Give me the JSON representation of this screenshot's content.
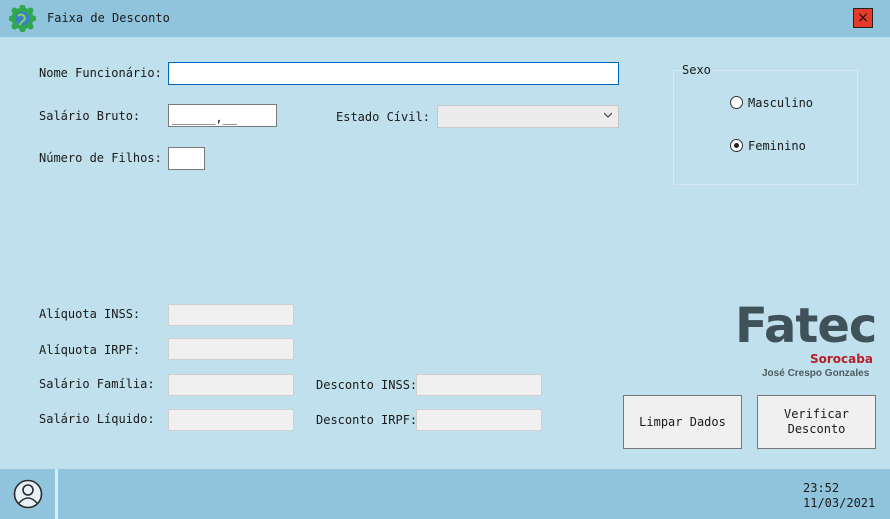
{
  "window": {
    "title": "Faixa de Desconto",
    "close_icon": "×"
  },
  "form": {
    "nome_label": "Nome Funcionário:",
    "nome_value": "",
    "salario_bruto_label": "Salário Bruto:",
    "salario_bruto_mask": "______,__",
    "estado_civil_label": "Estado Cívil:",
    "estado_civil_value": "",
    "filhos_label": "Número de Filhos:",
    "filhos_value": ""
  },
  "sexo": {
    "title": "Sexo",
    "masculino": "Masculino",
    "feminino": "Feminino",
    "selected": "Feminino"
  },
  "results": {
    "aliquota_inss_label": "Alíquota INSS:",
    "aliquota_irpf_label": "Alíquota IRPF:",
    "salario_familia_label": "Salário Família:",
    "salario_liquido_label": "Salário Líquido:",
    "desconto_inss_label": "Desconto INSS:",
    "desconto_irpf_label": "Desconto IRPF:"
  },
  "buttons": {
    "limpar": "Limpar Dados",
    "verificar_line1": "Verificar",
    "verificar_line2": "Desconto"
  },
  "logo": {
    "fatec": "Fatec",
    "sorocaba": "Sorocaba",
    "name": "José Crespo Gonzales"
  },
  "taskbar": {
    "time": "23:52",
    "date": "11/03/2021"
  },
  "colors": {
    "background": "#bfe0ec",
    "titlebar": "#8fc4dc",
    "close": "#e53a2a",
    "logo_red": "#b5202a"
  }
}
